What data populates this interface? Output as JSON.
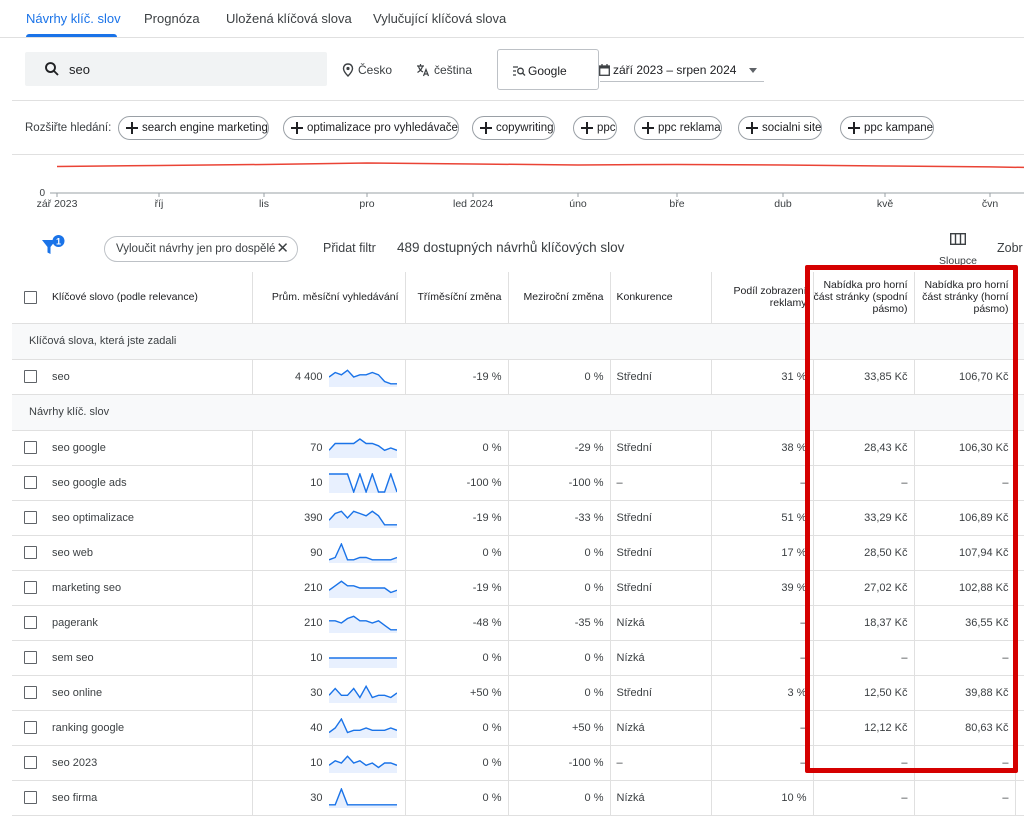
{
  "tabs": [
    {
      "label": "Návrhy klíč. slov",
      "active": true
    },
    {
      "label": "Prognóza"
    },
    {
      "label": "Uložená klíčová slova"
    },
    {
      "label": "Vylučující klíčová slova"
    }
  ],
  "search": {
    "value": "seo"
  },
  "location": "Česko",
  "language": "čeština",
  "network": "Google",
  "date_range": "září 2023 – srpen 2024",
  "expand": {
    "label": "Rozšiřte hledání:",
    "chips": [
      "search engine marketing",
      "optimalizace pro vyhledávače",
      "copywriting",
      "ppc",
      "ppc reklama",
      "socialni site",
      "ppc kampane"
    ]
  },
  "trend": {
    "y_zero": "0",
    "months": [
      "zář 2023",
      "říj",
      "lis",
      "pro",
      "led 2024",
      "úno",
      "bře",
      "dub",
      "kvě",
      "čvn"
    ],
    "values": [
      54,
      56,
      58,
      61,
      59,
      57,
      58,
      57,
      55,
      53
    ],
    "color": "#ea4335"
  },
  "toolbar": {
    "filter_badge": "1",
    "exclude_chip": "Vyloučit návrhy jen pro dospělé",
    "add_filter": "Přidat filtr",
    "count_text": "489 dostupných návrhů klíčových slov",
    "columns_label": "Sloupce",
    "view_label": "Zobr"
  },
  "columns": {
    "keyword": "Klíčové slovo (podle relevance)",
    "avg": "Prům. měsíční vyhledávání",
    "three_month": "Tříměsíční změna",
    "yoy": "Meziroční změna",
    "competition": "Konkurence",
    "share": "Podíl zobrazení reklamy",
    "bid_low": "Nabídka pro horní část stránky (spodní pásmo)",
    "bid_high": "Nabídka pro horní část stránky (horní pásmo)"
  },
  "sections": {
    "entered": "Klíčová slova, která jste zadali",
    "suggestions": "Návrhy klíč. slov"
  },
  "entered_rows": [
    {
      "kw": "seo",
      "avg": "4 400",
      "t3": "-19 %",
      "yoy": "0 %",
      "comp": "Střední",
      "share": "31 %",
      "low": "33,85 Kč",
      "high": "106,70 Kč",
      "trend": [
        5,
        3,
        4,
        2,
        5,
        4,
        4,
        3,
        4,
        7,
        8,
        8
      ]
    }
  ],
  "rows": [
    {
      "kw": "seo google",
      "avg": "70",
      "t3": "0 %",
      "yoy": "-29 %",
      "comp": "Střední",
      "share": "38 %",
      "low": "28,43 Kč",
      "high": "106,30 Kč",
      "trend": [
        6,
        3,
        3,
        3,
        3,
        1,
        3,
        3,
        4,
        6,
        5,
        6
      ]
    },
    {
      "kw": "seo google ads",
      "avg": "10",
      "t3": "-100 %",
      "yoy": "-100 %",
      "comp": "–",
      "share": "–",
      "low": "–",
      "high": "–",
      "trend": [
        1,
        1,
        1,
        1,
        9,
        1,
        9,
        1,
        9,
        9,
        1,
        9
      ]
    },
    {
      "kw": "seo optimalizace",
      "avg": "390",
      "t3": "-19 %",
      "yoy": "-33 %",
      "comp": "Střední",
      "share": "51 %",
      "low": "33,29 Kč",
      "high": "106,89 Kč",
      "trend": [
        6,
        3,
        2,
        5,
        2,
        3,
        4,
        2,
        4,
        8,
        8,
        8
      ]
    },
    {
      "kw": "seo web",
      "avg": "90",
      "t3": "0 %",
      "yoy": "0 %",
      "comp": "Střední",
      "share": "17 %",
      "low": "28,50 Kč",
      "high": "107,94 Kč",
      "trend": [
        8,
        7,
        1,
        8,
        8,
        7,
        7,
        8,
        8,
        8,
        8,
        7
      ]
    },
    {
      "kw": "marketing seo",
      "avg": "210",
      "t3": "-19 %",
      "yoy": "0 %",
      "comp": "Střední",
      "share": "39 %",
      "low": "27,02 Kč",
      "high": "102,88 Kč",
      "trend": [
        6,
        4,
        2,
        4,
        4,
        5,
        5,
        5,
        5,
        5,
        7,
        6
      ]
    },
    {
      "kw": "pagerank",
      "avg": "210",
      "t3": "-48 %",
      "yoy": "-35 %",
      "comp": "Nízká",
      "share": "–",
      "low": "18,37 Kč",
      "high": "36,55 Kč",
      "trend": [
        4,
        4,
        5,
        3,
        2,
        4,
        4,
        5,
        4,
        6,
        8,
        8
      ]
    },
    {
      "kw": "sem seo",
      "avg": "10",
      "t3": "0 %",
      "yoy": "0 %",
      "comp": "Nízká",
      "share": "–",
      "low": "–",
      "high": "–",
      "trend": [
        5,
        5,
        5,
        5,
        5,
        5,
        5,
        5,
        5,
        5,
        5,
        5
      ]
    },
    {
      "kw": "seo online",
      "avg": "30",
      "t3": "+50 %",
      "yoy": "0 %",
      "comp": "Střední",
      "share": "3 %",
      "low": "12,50 Kč",
      "high": "39,88 Kč",
      "trend": [
        6,
        3,
        6,
        6,
        3,
        7,
        2,
        7,
        6,
        6,
        7,
        5
      ]
    },
    {
      "kw": "ranking google",
      "avg": "40",
      "t3": "0 %",
      "yoy": "+50 %",
      "comp": "Nízká",
      "share": "–",
      "low": "12,12 Kč",
      "high": "80,63 Kč",
      "trend": [
        7,
        5,
        1,
        7,
        6,
        6,
        5,
        6,
        6,
        6,
        5,
        6
      ]
    },
    {
      "kw": "seo 2023",
      "avg": "10",
      "t3": "0 %",
      "yoy": "-100 %",
      "comp": "–",
      "share": "–",
      "low": "–",
      "high": "–",
      "trend": [
        6,
        4,
        5,
        2,
        5,
        4,
        6,
        5,
        7,
        5,
        5,
        6
      ]
    },
    {
      "kw": "seo firma",
      "avg": "30",
      "t3": "0 %",
      "yoy": "0 %",
      "comp": "Nízká",
      "share": "10 %",
      "low": "–",
      "high": "–",
      "trend": [
        8,
        8,
        1,
        8,
        8,
        8,
        8,
        8,
        8,
        8,
        8,
        8
      ]
    }
  ],
  "colors": {
    "accent": "#1a73e8",
    "highlight": "#d50000"
  }
}
